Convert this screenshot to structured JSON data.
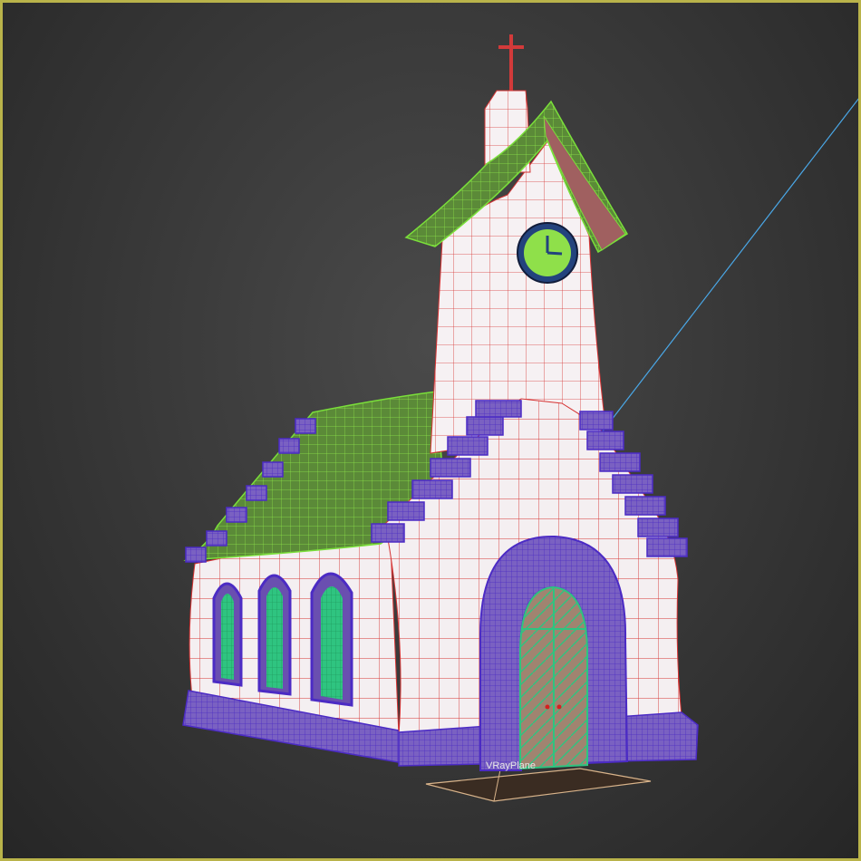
{
  "viewport": {
    "object_label": "VRayPlane",
    "active_border_color": "#b9b34a"
  },
  "colors": {
    "wall": "#f3eef0",
    "wall_edge": "#d63434",
    "stone": "#6a4fb0",
    "stone_edge": "#5b2fd6",
    "roof": "#5f8f3a",
    "roof_edge": "#7adf3a",
    "glass": "#2dbf7a",
    "door": "#9a8068",
    "clock_face": "#8fe04a",
    "clock_rim": "#2b4a8a",
    "cross": "#d23a3a",
    "light_line": "#4aa8e8"
  }
}
